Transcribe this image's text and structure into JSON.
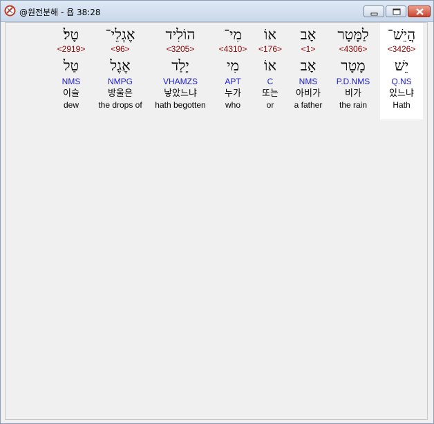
{
  "window": {
    "title": "@원전분해 - 욥 38:28"
  },
  "words": [
    {
      "hebrew": "הֲיֵשׁ־",
      "strong": "<3426>",
      "lemma": "יֵשׁ",
      "morph": "Q.NS",
      "korean": "있느냐",
      "english": "Hath",
      "selected": true
    },
    {
      "hebrew": "לַמָּטָר",
      "strong": "<4306>",
      "lemma": "מָטָר",
      "morph": "P.D.NMS",
      "korean": "비가",
      "english": "the rain",
      "selected": false
    },
    {
      "hebrew": "אָב",
      "strong": "<1>",
      "lemma": "אָב",
      "morph": "NMS",
      "korean": "아비가",
      "english": "a father",
      "selected": false
    },
    {
      "hebrew": "אוֹ",
      "strong": "<176>",
      "lemma": "אוֹ",
      "morph": "C",
      "korean": "또는",
      "english": "or",
      "selected": false
    },
    {
      "hebrew": "מִי־",
      "strong": "<4310>",
      "lemma": "מִי",
      "morph": "APT",
      "korean": "누가",
      "english": "who",
      "selected": false
    },
    {
      "hebrew": "הוֹלִיד",
      "strong": "<3205>",
      "lemma": "יָלַד",
      "morph": "VHAMZS",
      "korean": "낳았느냐",
      "english": "hath begotten",
      "selected": false
    },
    {
      "hebrew": "אֶגְלֵי־",
      "strong": "<96>",
      "lemma": "אֶגֶל",
      "morph": "NMPG",
      "korean": "방울은",
      "english": "the drops of",
      "selected": false
    },
    {
      "hebrew": "טָל׃",
      "strong": "<2919>",
      "lemma": "טַל",
      "morph": "NMS",
      "korean": "이슬",
      "english": "dew",
      "selected": false
    }
  ]
}
